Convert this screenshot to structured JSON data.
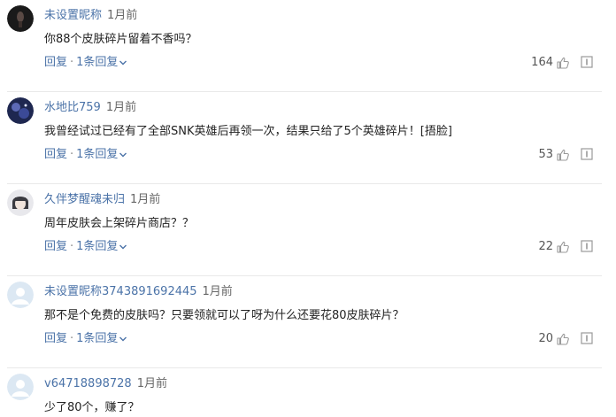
{
  "comments": [
    {
      "nickname": "未设置昵称",
      "time": "1月前",
      "text": "你88个皮肤碎片留着不香吗？",
      "reply_label": "回复",
      "sep": "·",
      "reply_count_label": "1条回复",
      "likes": "164",
      "avatar_icon": "avatar-dark-icon"
    },
    {
      "nickname": "水地比759",
      "time": "1月前",
      "text": "我曾经试过已经有了全部SNK英雄后再领一次，结果只给了5个英雄碎片！[捂脸]",
      "reply_label": "回复",
      "sep": "·",
      "reply_count_label": "1条回复",
      "likes": "53",
      "avatar_icon": "avatar-space-icon"
    },
    {
      "nickname": "久伴梦醒魂未归",
      "time": "1月前",
      "text": "周年皮肤会上架碎片商店？？",
      "reply_label": "回复",
      "sep": "·",
      "reply_count_label": "1条回复",
      "likes": "22",
      "avatar_icon": "avatar-portrait-icon"
    },
    {
      "nickname": "未设置昵称3743891692445",
      "time": "1月前",
      "text": "那不是个免费的皮肤吗？只要领就可以了呀为什么还要花80皮肤碎片？",
      "reply_label": "回复",
      "sep": "·",
      "reply_count_label": "1条回复",
      "likes": "20",
      "avatar_icon": "avatar-default-icon"
    },
    {
      "nickname": "v64718898728",
      "time": "1月前",
      "text": "少了80个，赚了？",
      "avatar_icon": "avatar-default-icon"
    }
  ],
  "colors": {
    "nickname": "#4b73a8",
    "action": "#4b73a8",
    "separator": "#e9e9e9"
  }
}
